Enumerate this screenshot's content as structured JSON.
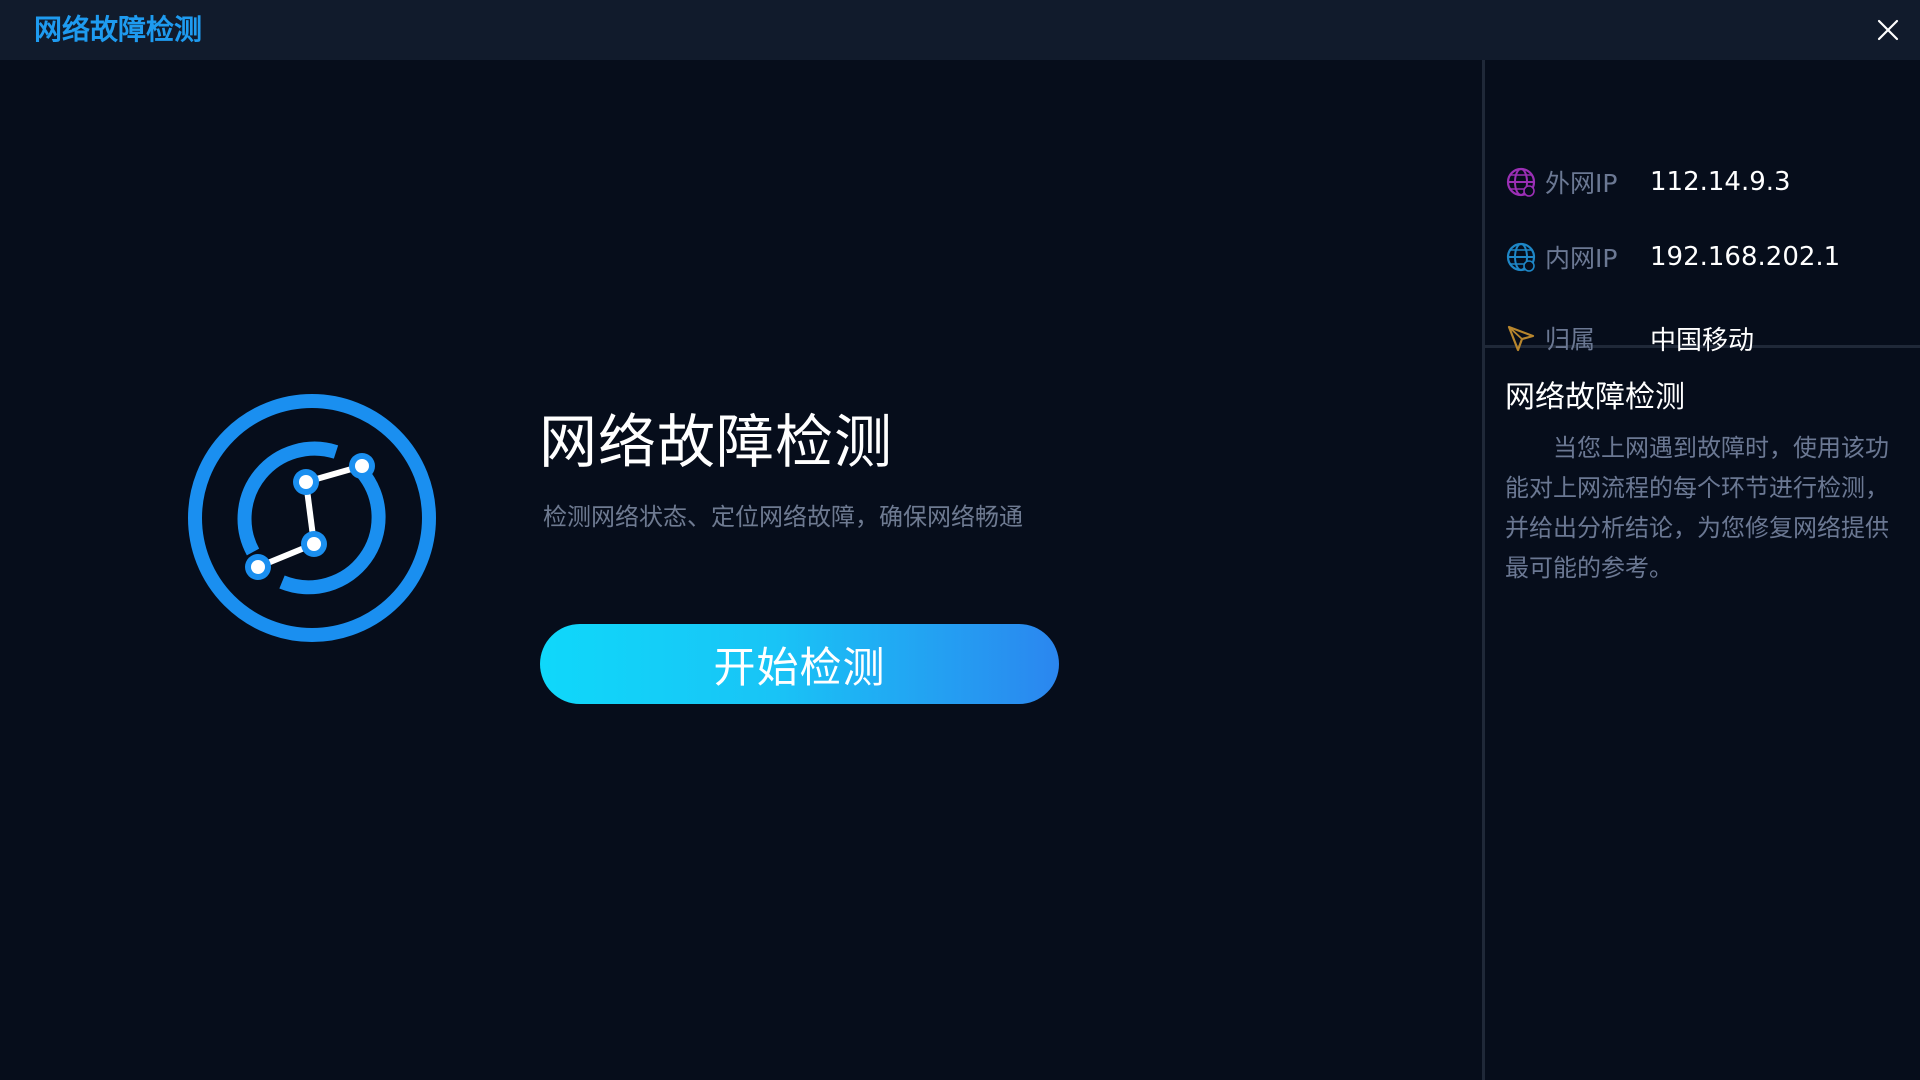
{
  "window": {
    "title": "网络故障检测",
    "close_icon": "close-icon"
  },
  "main": {
    "logo_icon": "network-diagnosis-icon",
    "title": "网络故障检测",
    "subtitle": "检测网络状态、定位网络故障，确保网络畅通",
    "start_button_label": "开始检测"
  },
  "network_info": [
    {
      "icon": "globe-icon",
      "label": "外网IP",
      "value": "112.14.9.3",
      "icon_color": "#9b2fb5"
    },
    {
      "icon": "globe-icon",
      "label": "内网IP",
      "value": "192.168.202.1",
      "icon_color": "#1e86c6"
    },
    {
      "icon": "location-arrow-icon",
      "label": "归属",
      "value": "中国移动",
      "icon_color": "#b8862d"
    }
  ],
  "description": {
    "title": "网络故障检测",
    "text": "当您上网遇到故障时，使用该功能对上网流程的每个环节进行检测，并给出分析结论，为您修复网络提供最可能的参考。"
  },
  "colors": {
    "accent": "#1e9bf0",
    "background": "#060d1b",
    "titlebar": "#111b2c",
    "button_start": "#0fd8fa",
    "button_end": "#2b86ef"
  }
}
